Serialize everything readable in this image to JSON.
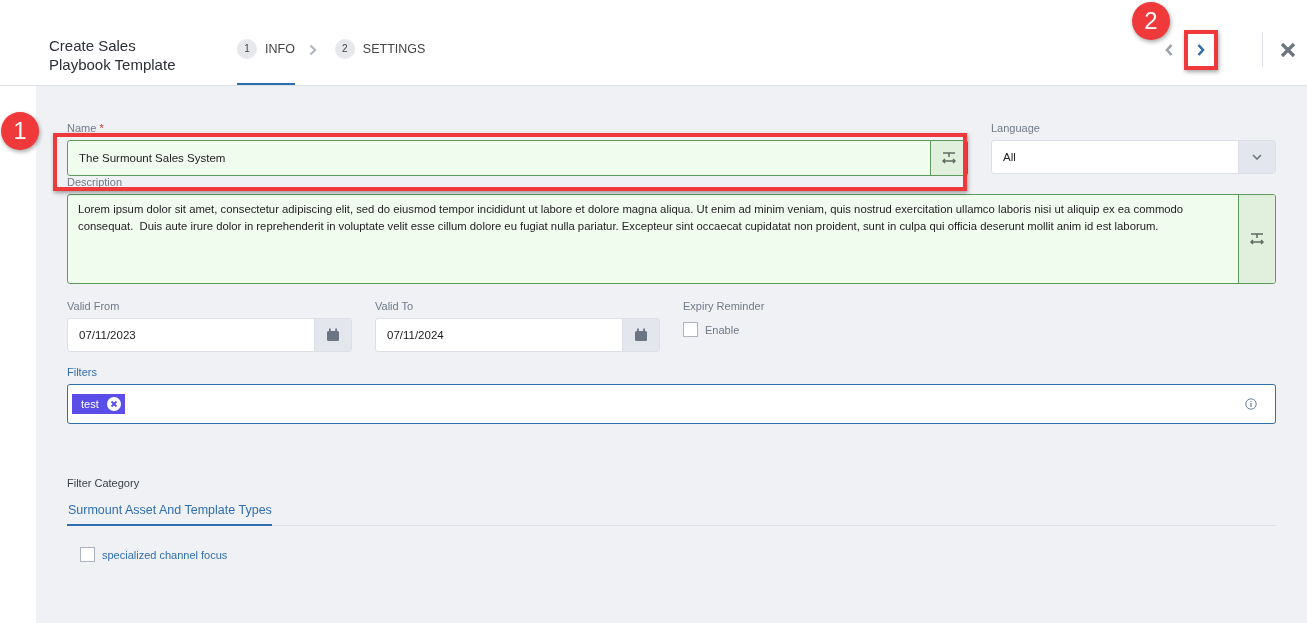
{
  "header": {
    "title": "Create Sales Playbook Template",
    "steps": [
      {
        "number": "1",
        "label": "INFO",
        "selected": true
      },
      {
        "number": "2",
        "label": "SETTINGS",
        "selected": false
      }
    ],
    "prev": {
      "disabled": true
    },
    "next": {
      "disabled": false
    }
  },
  "name": {
    "label": "Name",
    "required_mark": "*",
    "value": "The Surmount Sales System"
  },
  "language": {
    "label": "Language",
    "value": "All"
  },
  "description": {
    "label": "Description",
    "value": "Lorem ipsum dolor sit amet, consectetur adipiscing elit, sed do eiusmod tempor incididunt ut labore et dolore magna aliqua. Ut enim ad minim veniam, quis nostrud exercitation ullamco laboris nisi ut aliquip ex ea commodo consequat.  Duis aute irure dolor in reprehenderit in voluptate velit esse cillum dolore eu fugiat nulla pariatur. Excepteur sint occaecat cupidatat non proident, sunt in culpa qui officia deserunt mollit anim id est laborum."
  },
  "valid_from": {
    "label": "Valid From",
    "value": "07/11/2023"
  },
  "valid_to": {
    "label": "Valid To",
    "value": "07/11/2024"
  },
  "expiry_reminder": {
    "label": "Expiry Reminder",
    "option": "Enable",
    "checked": false
  },
  "filters": {
    "label": "Filters",
    "tags": [
      {
        "label": "test"
      }
    ]
  },
  "filter_category": {
    "label": "Filter Category",
    "tabs": [
      {
        "label": "Surmount Asset And Template Types",
        "selected": true
      }
    ],
    "options": [
      {
        "label": "specialized channel focus",
        "checked": false
      }
    ]
  },
  "annotations": [
    {
      "label": "1"
    },
    {
      "label": "2"
    }
  ]
}
